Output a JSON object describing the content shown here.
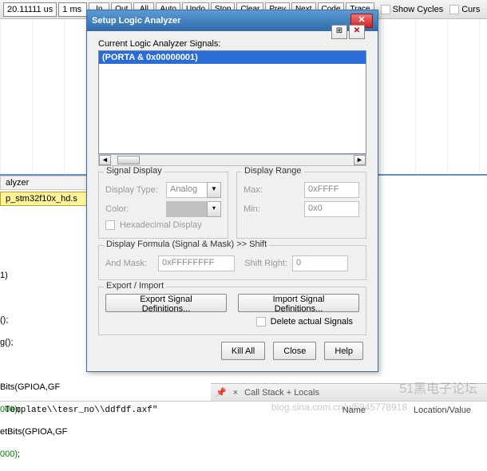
{
  "toolbar": {
    "time_value": "20.11111 us",
    "grid_value": "1 ms",
    "buttons": [
      "In",
      "Out",
      "All",
      "Auto",
      "Undo",
      "Stop",
      "Clear",
      "Prev",
      "Next",
      "Code",
      "Trace"
    ],
    "show_cycles": "Show Cycles",
    "cursor": "Curs"
  },
  "tabs": {
    "main": "alyzer",
    "file": "p_stm32f10x_hd.s"
  },
  "code": {
    "line1": "1)",
    "line2": "();",
    "line3": "g();",
    "line4": "Bits(GPIOA,GF",
    "num4": "000)",
    "semi4": ";",
    "line5": "etBits(GPIOA,GF",
    "num5": "000)",
    "semi5": ";"
  },
  "dialog": {
    "title": "Setup Logic Analyzer",
    "signals_label": "Current Logic Analyzer Signals:",
    "signal_row": "(PORTA & 0x00000001)",
    "add_icon": "⊞",
    "del_icon": "✕",
    "signal_display": {
      "legend": "Signal Display",
      "type_label": "Display Type:",
      "type_value": "Analog",
      "color_label": "Color:",
      "hex_label": "Hexadecimal Display"
    },
    "display_range": {
      "legend": "Display Range",
      "max_label": "Max:",
      "max_value": "0xFFFF",
      "min_label": "Min:",
      "min_value": "0x0"
    },
    "formula": {
      "legend": "Display Formula (Signal & Mask) >> Shift",
      "mask_label": "And Mask:",
      "mask_value": "0xFFFFFFFF",
      "shift_label": "Shift Right:",
      "shift_value": "0"
    },
    "export": {
      "legend": "Export / Import",
      "export_btn": "Export Signal Definitions...",
      "import_btn": "Import Signal Definitions...",
      "delete_label": "Delete actual Signals"
    },
    "actions": {
      "kill": "Kill All",
      "close": "Close",
      "help": "Help"
    }
  },
  "status": {
    "text": "Call Stack + Locals",
    "pin": "📌",
    "x": "×"
  },
  "footer": {
    "path": "Template\\\\tesr_no\\\\ddfdf.axf\"",
    "col1": "Name",
    "col2": "Location/Value"
  },
  "watermark1": "51黑电子论坛",
  "watermark2": "blog.sina.com.cn/u/5945778918"
}
